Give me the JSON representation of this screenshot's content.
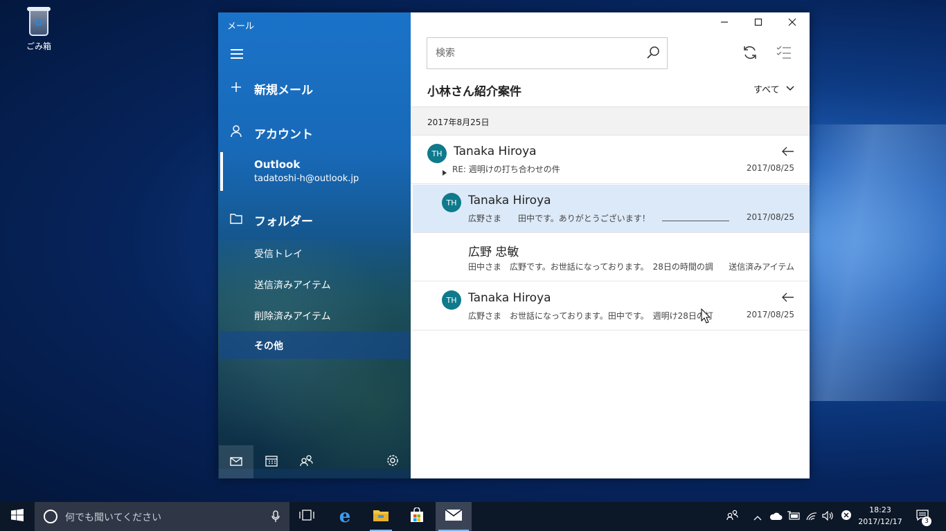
{
  "desktop": {
    "recycle_bin_label": "ごみ箱"
  },
  "window": {
    "app_title": "メール"
  },
  "nav": {
    "new_mail": "新規メール",
    "accounts": "アカウント",
    "account": {
      "name": "Outlook",
      "email": "tadatoshi-h@outlook.jp"
    },
    "folders": "フォルダー",
    "folder_items": [
      "受信トレイ",
      "送信済みアイテム",
      "削除済みアイテム"
    ],
    "selected_folder": "その他"
  },
  "search": {
    "placeholder": "検索"
  },
  "list": {
    "title": "小林さん紹介案件",
    "filter_label": "すべて",
    "date_group": "2017年8月25日",
    "messages": [
      {
        "initials": "TH",
        "sender": "Tanaka Hiroya",
        "preview": "RE: 週明けの打ち合わせの件",
        "date": "2017/08/25",
        "replied": true
      },
      {
        "initials": "TH",
        "sender": "Tanaka Hiroya",
        "preview": "広野さま　　田中です。ありがとうございます！",
        "date": "2017/08/25",
        "selected": true
      },
      {
        "initials": "",
        "sender": "広野 忠敏",
        "preview": "田中さま　広野です。お世話になっております。　28日の時間の調",
        "tag": "送信済みアイテム"
      },
      {
        "initials": "TH",
        "sender": "Tanaka Hiroya",
        "preview": "広野さま　お世話になっております。田中です。　週明け28日の打",
        "date": "2017/08/25",
        "replied": true
      }
    ]
  },
  "taskbar": {
    "search_placeholder": "何でも聞いてください",
    "time": "18:23",
    "date": "2017/12/17",
    "notification_count": "3"
  },
  "colors": {
    "accent": "#1a73c8",
    "avatar": "#0f7a8c",
    "selected_row": "#dce9f8",
    "taskbar": "#0c1727"
  }
}
